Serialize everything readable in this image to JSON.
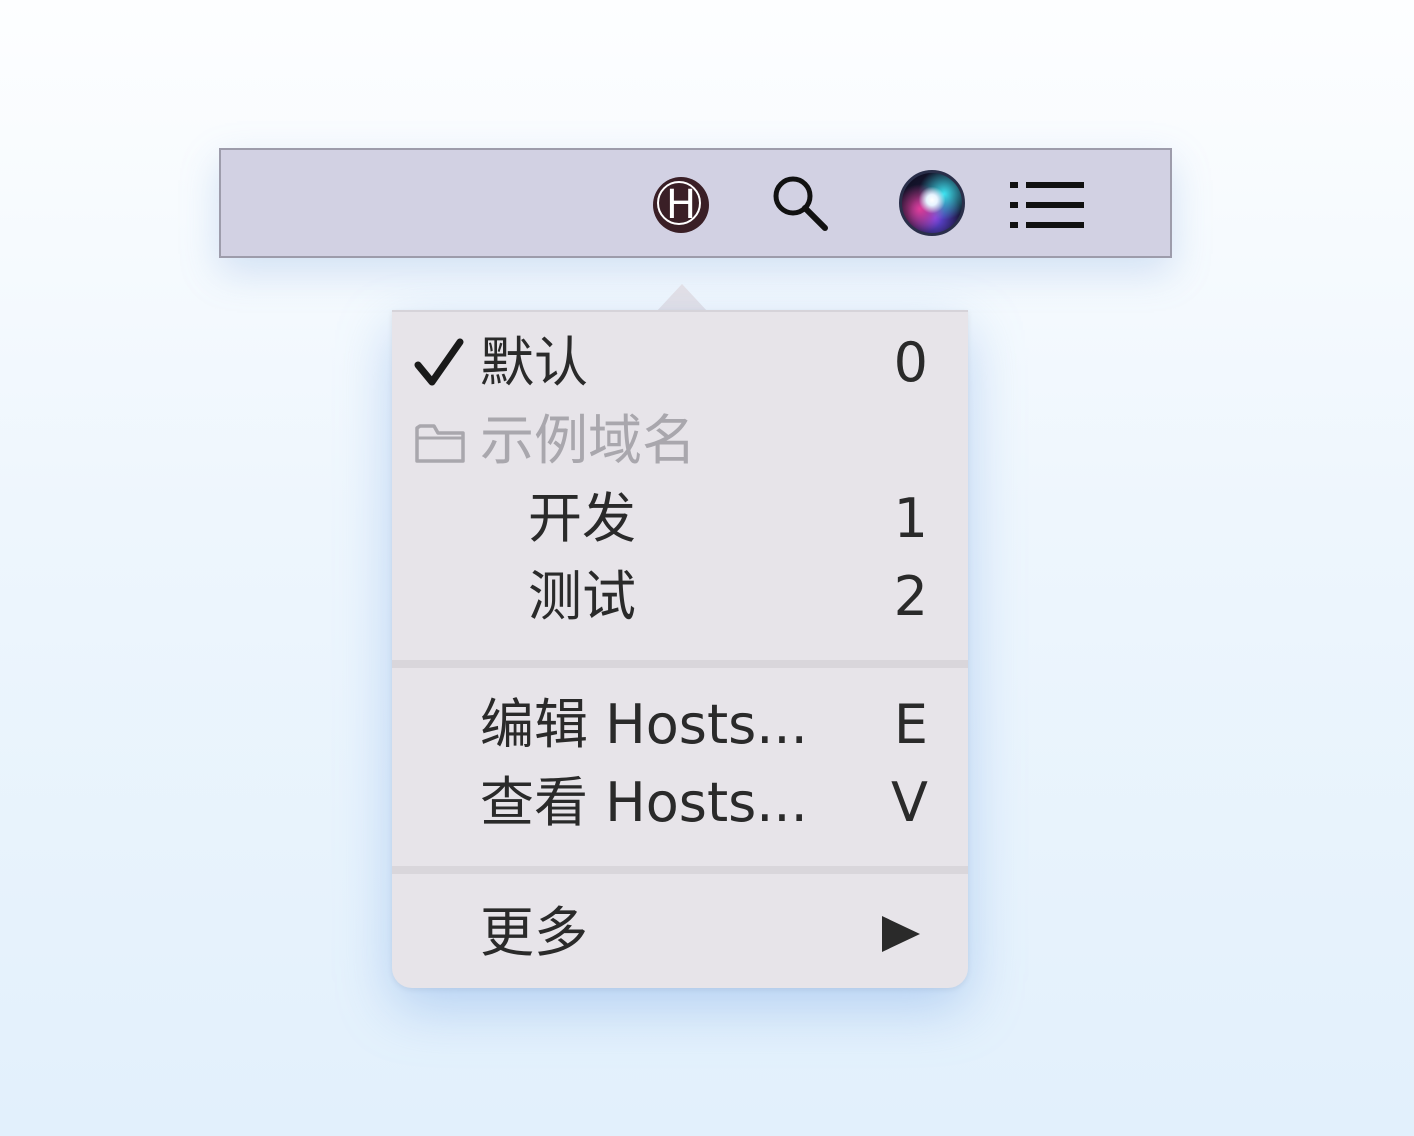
{
  "menubar": {
    "icons": [
      {
        "name": "hostbuddy-icon",
        "glyph": "H"
      },
      {
        "name": "search-icon"
      },
      {
        "name": "siri-icon"
      },
      {
        "name": "list-icon"
      }
    ]
  },
  "menu": {
    "items": [
      {
        "label": "默认",
        "key": "0",
        "checked": true
      },
      {
        "label": "示例域名",
        "disabled": true,
        "icon": "folder-icon"
      },
      {
        "label": "开发",
        "key": "1"
      },
      {
        "label": "测试",
        "key": "2"
      },
      {
        "label": "编辑 Hosts...",
        "key": "E"
      },
      {
        "label": "查看 Hosts...",
        "key": "V"
      },
      {
        "label": "更多",
        "submenu": true
      }
    ]
  },
  "colors": {
    "menubar_bg": "#d2d1e3",
    "menu_bg": "#e7e4e9",
    "text": "#2a2a2a",
    "disabled_text": "#a9a7ad"
  }
}
